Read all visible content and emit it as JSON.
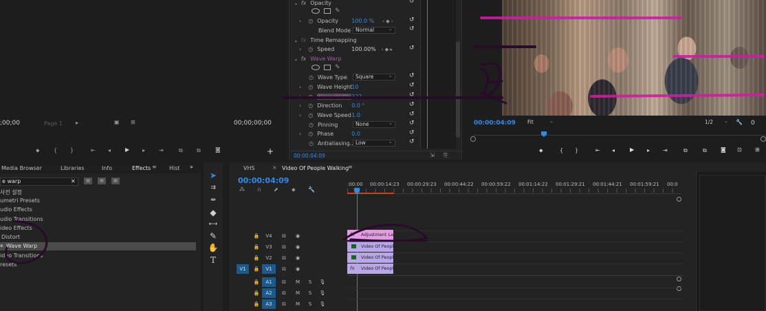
{
  "source_monitor": {
    "tc_left": ";00;00",
    "page": "Page 1",
    "tc_right": "00;00;00;00"
  },
  "effect_controls": {
    "opacity_section": "Opacity",
    "opacity_label": "Opacity",
    "opacity_value": "100.0 %",
    "blend_mode_label": "Blend Mode",
    "blend_mode_value": "Normal",
    "time_remap_section": "Time Remapping",
    "speed_label": "Speed",
    "speed_value": "100.00%",
    "wave_warp_section": "Wave Warp",
    "wave_type_label": "Wave Type",
    "wave_type_value": "Square",
    "wave_height_label": "Wave Height",
    "wave_height_value": "10",
    "wave_width_label": "Wave Width",
    "wave_width_value": "322",
    "direction_label": "Direction",
    "direction_value": "0.0 °",
    "wave_speed_label": "Wave Speed",
    "wave_speed_value": "1.0",
    "pinning_label": "Pinning",
    "pinning_value": "None",
    "phase_label": "Phase",
    "phase_value": "0.0",
    "antialiasing_label": "Antialiasing...",
    "antialiasing_value": "Low",
    "timecode": "00:00:04:09"
  },
  "program_monitor": {
    "timecode": "00:00:04:09",
    "fit": "Fit",
    "resolution": "1/2"
  },
  "effects_panel": {
    "tabs": [
      "Media Browser",
      "Libraries",
      "Info",
      "Effects",
      "Hist"
    ],
    "search_value": "e warp",
    "tree": [
      "사전 설정",
      "umetri Presets",
      "udio Effects",
      "udio Transitions",
      "ideo Effects",
      "Distort",
      "Wave Warp",
      "ideo Transitions",
      "resets"
    ]
  },
  "timeline": {
    "tabs": [
      "VHS",
      "Video Of People Walking"
    ],
    "timecode": "00:00:04:09",
    "ruler": [
      ":00:00",
      "00:00:14:23",
      "00:00:29:23",
      "00:00:44:22",
      "00:00:59:22",
      "00:01:14:22",
      "00:01:29:21",
      "00:01:44:21",
      "00:01:59:21",
      "00:0"
    ],
    "tracks_video": [
      "V4",
      "V3",
      "V2",
      "V1"
    ],
    "tracks_audio": [
      "A1",
      "A2",
      "A3"
    ],
    "source_patch_video": "V1",
    "mute": "M",
    "solo": "S",
    "clips": [
      "Adjustment La",
      "Video Of Peopl",
      "Video Of Peopl",
      "Video Of Peopl"
    ]
  },
  "colors": {
    "accent_blue": "#2d8ceb",
    "adjustment_clip": "#e39be6",
    "video_clip": "#b9a6e6",
    "annotation": "#3a0f3a"
  }
}
